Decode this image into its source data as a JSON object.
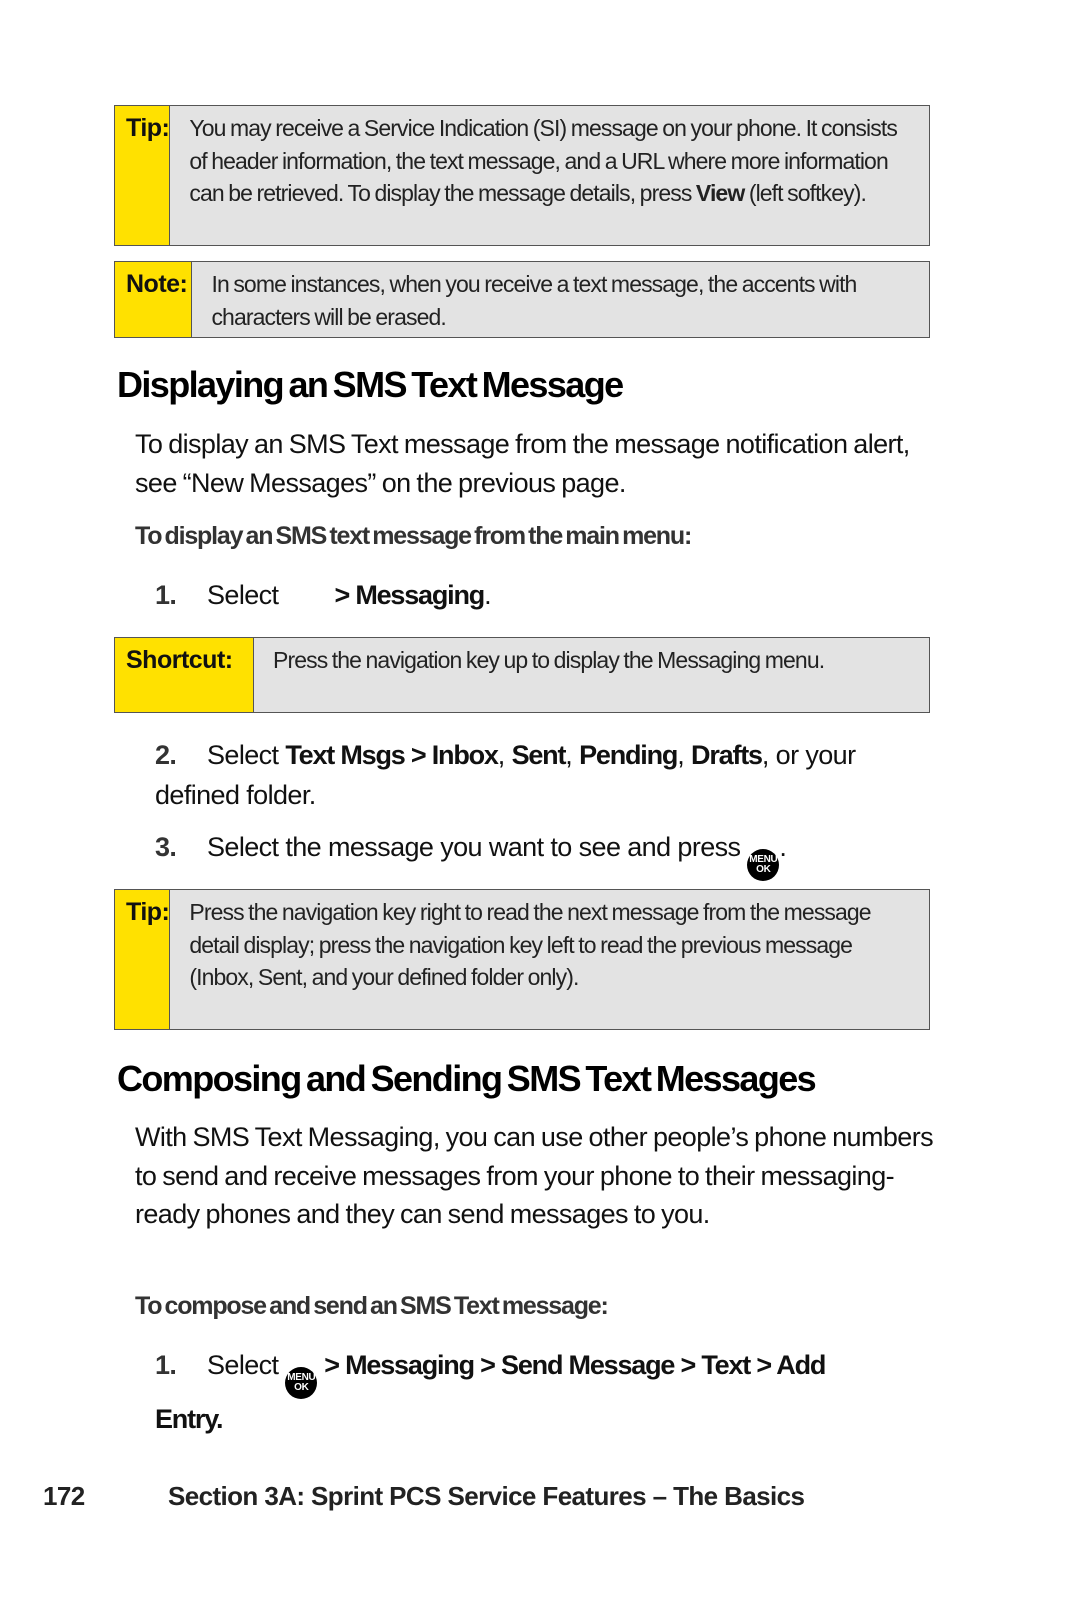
{
  "tip1": {
    "label": "Tip:",
    "text_before": "You may receive a Service Indication (SI) message on your phone. It consists of header information, the text message, and a URL where more information can be retrieved. To display the message details, press ",
    "bold": "View",
    "text_after": " (left softkey)."
  },
  "note": {
    "label": "Note:",
    "text": "In some instances, when you receive a text message, the accents with characters will be erased."
  },
  "section1": {
    "heading": "Displaying an SMS Text Message",
    "intro": "To display an SMS Text message from the message notification alert, see “New Messages” on the previous page.",
    "subheading": "To display an SMS text message from the main menu:",
    "step1": {
      "num": "1.",
      "text": "Select",
      "bold": "> Messaging",
      "end": "."
    },
    "shortcut": {
      "label": "Shortcut:",
      "text": "Press the navigation key up to display the Messaging menu."
    },
    "step2": {
      "num": "2.",
      "pre": "Select ",
      "b1": "Text Msgs > Inbox",
      "s1": ", ",
      "b2": "Sent",
      "s2": ", ",
      "b3": "Pending",
      "s3": ", ",
      "b4": "Drafts",
      "post": ", or your defined folder."
    },
    "step3": {
      "num": "3.",
      "text": "Select the message you want to see and press",
      "icon": "menu-ok-icon",
      "end": "."
    },
    "tip2": {
      "label": "Tip:",
      "text": "Press the navigation key right to read the next message from the message detail display; press the navigation key left to read the previous message (Inbox, Sent, and your defined folder only)."
    }
  },
  "section2": {
    "heading": "Composing and Sending SMS Text Messages",
    "intro": "With SMS Text Messaging, you can use other people’s phone numbers to send and receive messages from your phone to their messaging-ready phones and they can send messages to you.",
    "subheading": "To compose and send an SMS Text message:",
    "step1": {
      "num": "1.",
      "text": "Select",
      "icon": "menu-ok-icon",
      "bold": "> Messaging > Send Message > Text > Add Entry."
    }
  },
  "menu_icon": {
    "line1": "MENU",
    "line2": "OK"
  },
  "footer": {
    "page": "172",
    "section": "Section 3A: Sprint PCS Service Features – The Basics"
  }
}
